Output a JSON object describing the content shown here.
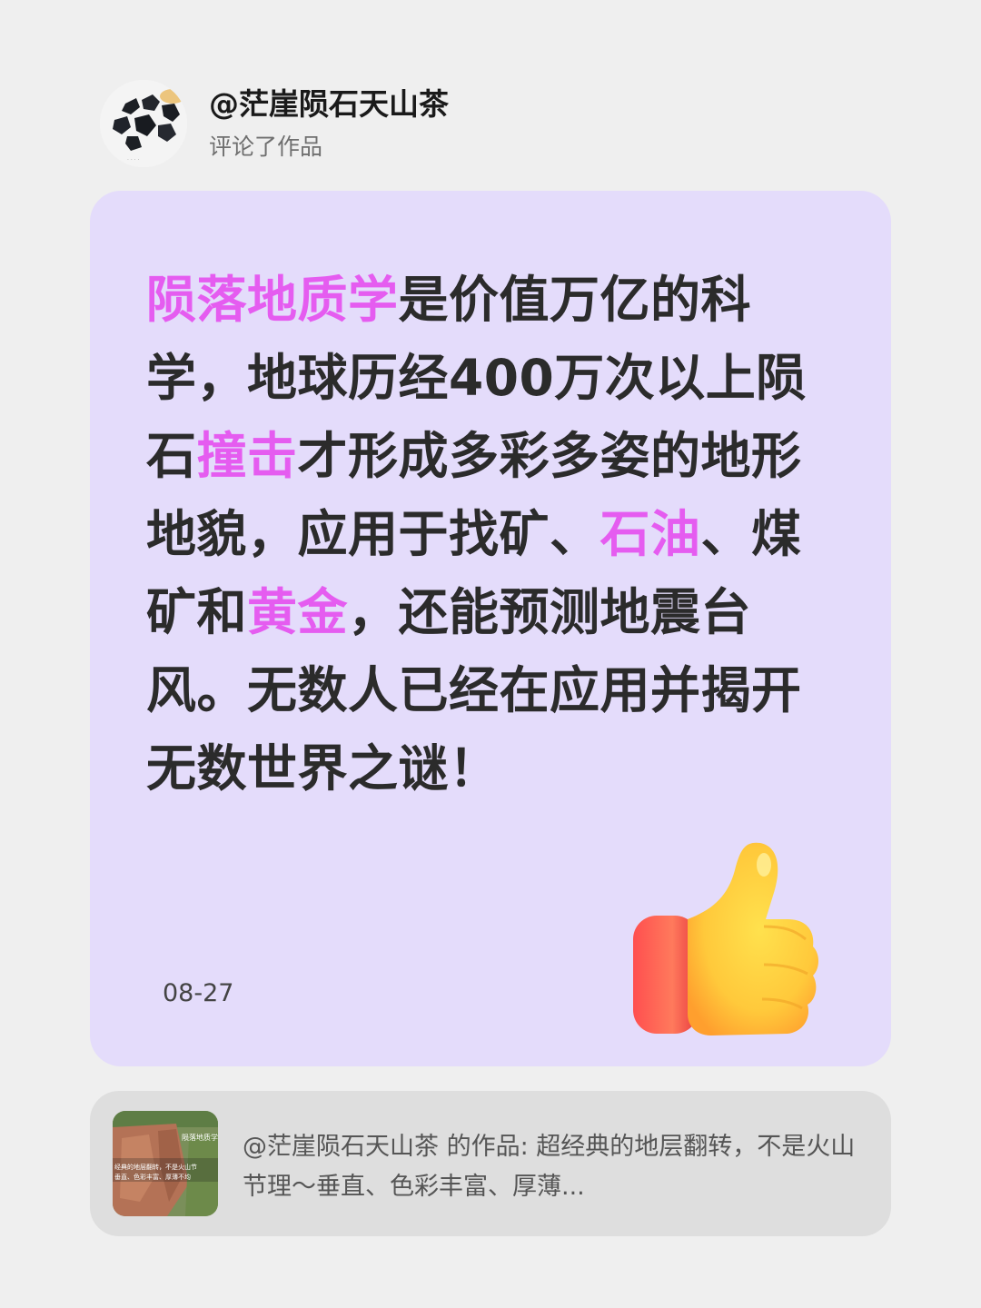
{
  "header": {
    "username": "@茫崖陨石天山茶",
    "action": "评论了作品"
  },
  "comment": {
    "segments": [
      {
        "text": "陨落地质学",
        "highlight": true
      },
      {
        "text": "是价值万亿的科学，地球历经400万次以上陨石",
        "highlight": false
      },
      {
        "text": "撞击",
        "highlight": true
      },
      {
        "text": "才形成多彩多姿的地形地貌，应用于找矿、",
        "highlight": false
      },
      {
        "text": "石油",
        "highlight": true
      },
      {
        "text": "、煤矿和",
        "highlight": false
      },
      {
        "text": "黄金",
        "highlight": true
      },
      {
        "text": "，还能预测地震台风。无数人已经在应用并揭开无数世界之谜！",
        "highlight": false
      }
    ],
    "date": "08-27",
    "reaction_icon": "thumbs-up-icon",
    "highlight_color": "#e55cf0"
  },
  "work": {
    "text": "@茫崖陨石天山茶  的作品: 超经典的地层翻转，不是火山节理～垂直、色彩丰富、厚薄...",
    "thumbnail_text": "陨落地质学",
    "thumbnail_lines": [
      "经典的地层翻转，不是火山节",
      "垂直、色彩丰富、厚薄不均"
    ]
  }
}
